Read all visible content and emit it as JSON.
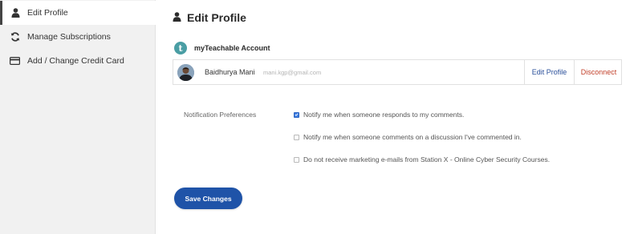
{
  "colors": {
    "accent": "#1f53a8",
    "link": "#2a4f9a",
    "danger": "#c2402a",
    "teachable": "#4a9ea4",
    "sidebar_bg": "#f1f1f1"
  },
  "sidebar": {
    "items": [
      {
        "label": "Edit Profile",
        "icon": "user-icon",
        "active": true
      },
      {
        "label": "Manage Subscriptions",
        "icon": "refresh-icon",
        "active": false
      },
      {
        "label": "Add / Change Credit Card",
        "icon": "credit-card-icon",
        "active": false
      }
    ]
  },
  "main": {
    "title": "Edit Profile",
    "title_icon": "user-icon",
    "account": {
      "logo_letter": "t",
      "title": "myTeachable Account",
      "user_name": "Baidhurya Mani",
      "user_email": "mani.kgp@gmail.com",
      "edit_label": "Edit Profile",
      "disconnect_label": "Disconnect"
    },
    "notifications": {
      "label": "Notification Preferences",
      "options": [
        {
          "text": "Notify me when someone responds to my comments.",
          "checked": true
        },
        {
          "text": "Notify me when someone comments on a discussion I've commented in.",
          "checked": false
        },
        {
          "text": "Do not receive marketing e-mails from Station X - Online Cyber Security Courses.",
          "checked": false
        }
      ]
    },
    "save_label": "Save Changes"
  }
}
